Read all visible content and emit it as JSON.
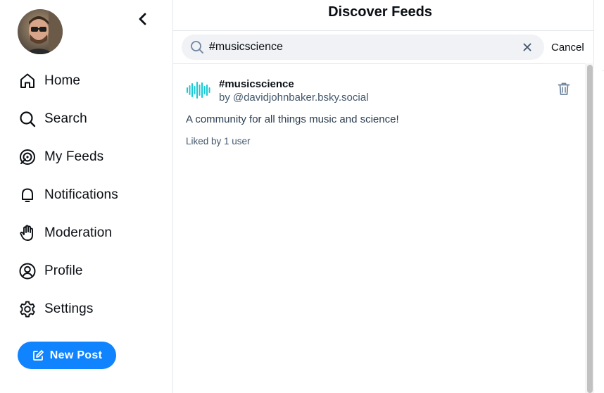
{
  "sidebar": {
    "nav": [
      {
        "label": "Home",
        "icon": "home-icon"
      },
      {
        "label": "Search",
        "icon": "search-icon"
      },
      {
        "label": "My Feeds",
        "icon": "feeds-icon"
      },
      {
        "label": "Notifications",
        "icon": "bell-icon"
      },
      {
        "label": "Moderation",
        "icon": "hand-icon"
      },
      {
        "label": "Profile",
        "icon": "profile-icon"
      },
      {
        "label": "Settings",
        "icon": "gear-icon"
      }
    ],
    "new_post_label": "New Post"
  },
  "main": {
    "title": "Discover Feeds",
    "search": {
      "value": "#musicscience",
      "cancel_label": "Cancel"
    },
    "feeds": [
      {
        "name": "#musicscience",
        "by_prefix": "by",
        "author": "@davidjohnbaker.bsky.social",
        "description": "A community for all things music and science!",
        "likes": "Liked by 1 user"
      }
    ]
  },
  "colors": {
    "accent": "#1083fe",
    "feed_avatar": "#19c9d6",
    "text_secondary": "#42576c"
  }
}
